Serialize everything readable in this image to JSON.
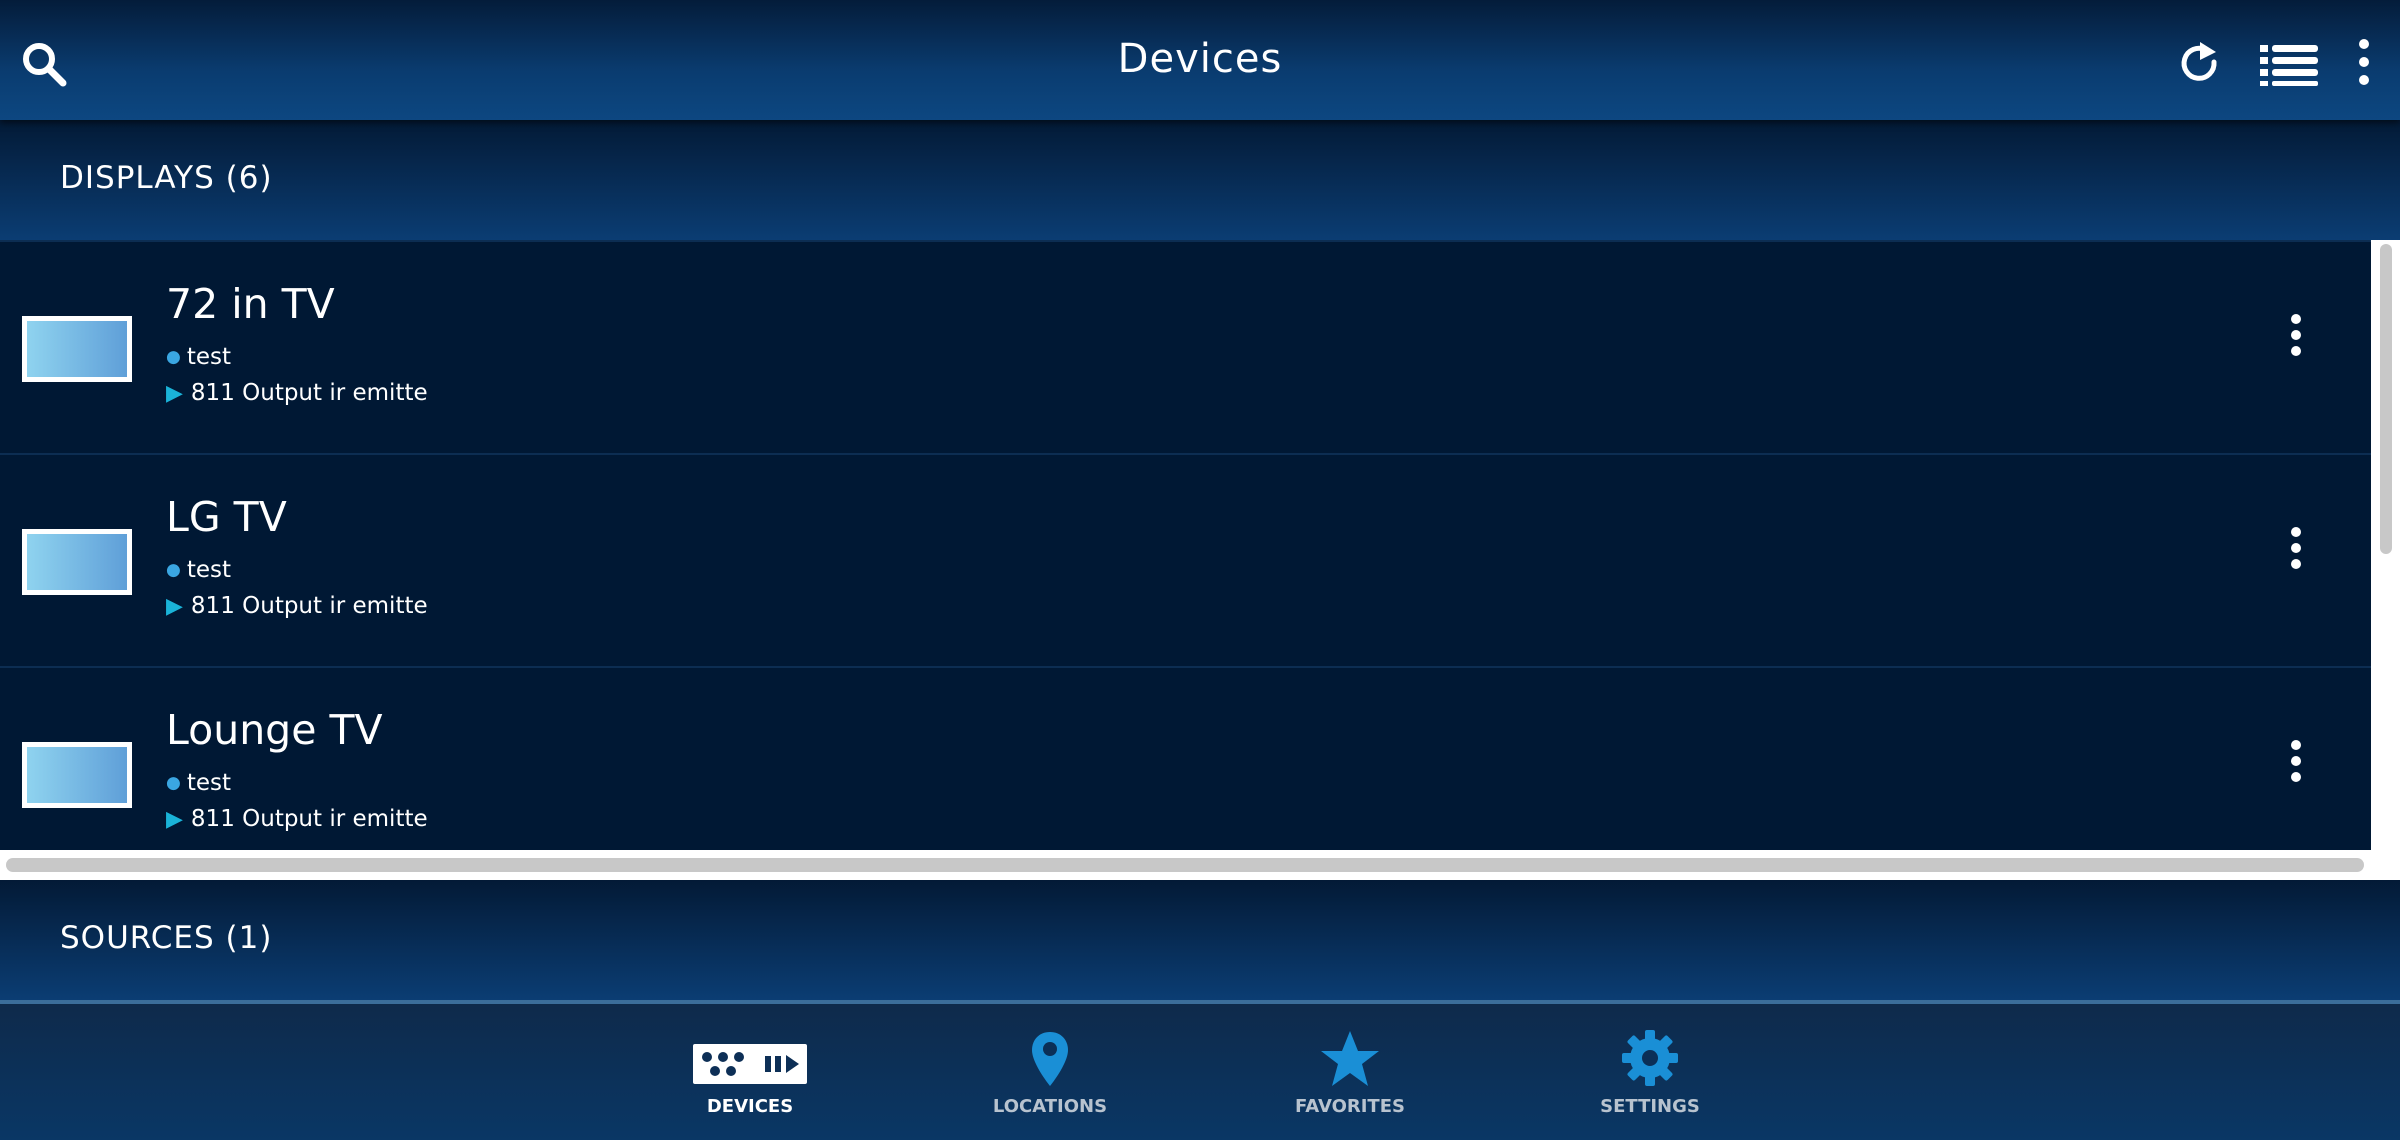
{
  "header": {
    "title": "Devices",
    "icons": [
      "search-icon",
      "refresh-icon",
      "list-view-icon",
      "more-vert-icon"
    ]
  },
  "sections": {
    "displays_label": "DISPLAYS (6)",
    "sources_label": "SOURCES (1)"
  },
  "devices": [
    {
      "name": "72 in TV",
      "location": "test",
      "source": "811 Output ir emitte"
    },
    {
      "name": "LG TV",
      "location": "test",
      "source": "811 Output ir emitte"
    },
    {
      "name": "Lounge TV",
      "location": "test",
      "source": "811 Output ir emitte"
    }
  ],
  "nav": [
    {
      "label": "DEVICES",
      "icon": "devices-icon",
      "active": true
    },
    {
      "label": "LOCATIONS",
      "icon": "location-pin-icon",
      "active": false
    },
    {
      "label": "FAVORITES",
      "icon": "star-icon",
      "active": false
    },
    {
      "label": "SETTINGS",
      "icon": "gear-icon",
      "active": false
    }
  ],
  "colors": {
    "header": "#0a3c70",
    "list_bg": "#001834",
    "accent": "#1a8fd6",
    "pin": "#3aa6e2",
    "play": "#1ab3d8"
  }
}
